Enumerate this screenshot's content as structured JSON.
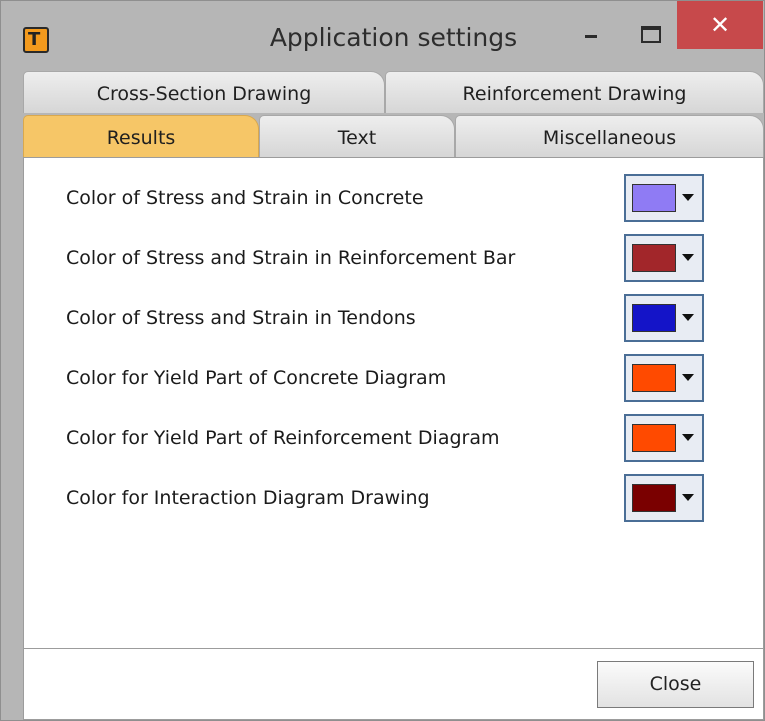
{
  "window": {
    "title": "Application settings",
    "close_glyph": "✕"
  },
  "tabs_row1": [
    {
      "label": "Cross-Section Drawing"
    },
    {
      "label": "Reinforcement Drawing"
    }
  ],
  "tabs_row2": [
    {
      "label": "Results"
    },
    {
      "label": "Text"
    },
    {
      "label": "Miscellaneous"
    }
  ],
  "settings": [
    {
      "label": "Color of Stress and Strain in Concrete",
      "color": "#8f7bf4"
    },
    {
      "label": "Color of Stress and Strain in Reinforcement Bar",
      "color": "#a2262a"
    },
    {
      "label": "Color of Stress and Strain in Tendons",
      "color": "#1414c8"
    },
    {
      "label": "Color for Yield Part of Concrete Diagram",
      "color": "#ff4a00"
    },
    {
      "label": "Color for Yield Part of Reinforcement Diagram",
      "color": "#ff4a00"
    },
    {
      "label": "Color for Interaction Diagram Drawing",
      "color": "#7a0000"
    }
  ],
  "footer": {
    "close_label": "Close"
  },
  "colors": {
    "active_tab": "#f6c667",
    "close_button": "#c7494b"
  }
}
